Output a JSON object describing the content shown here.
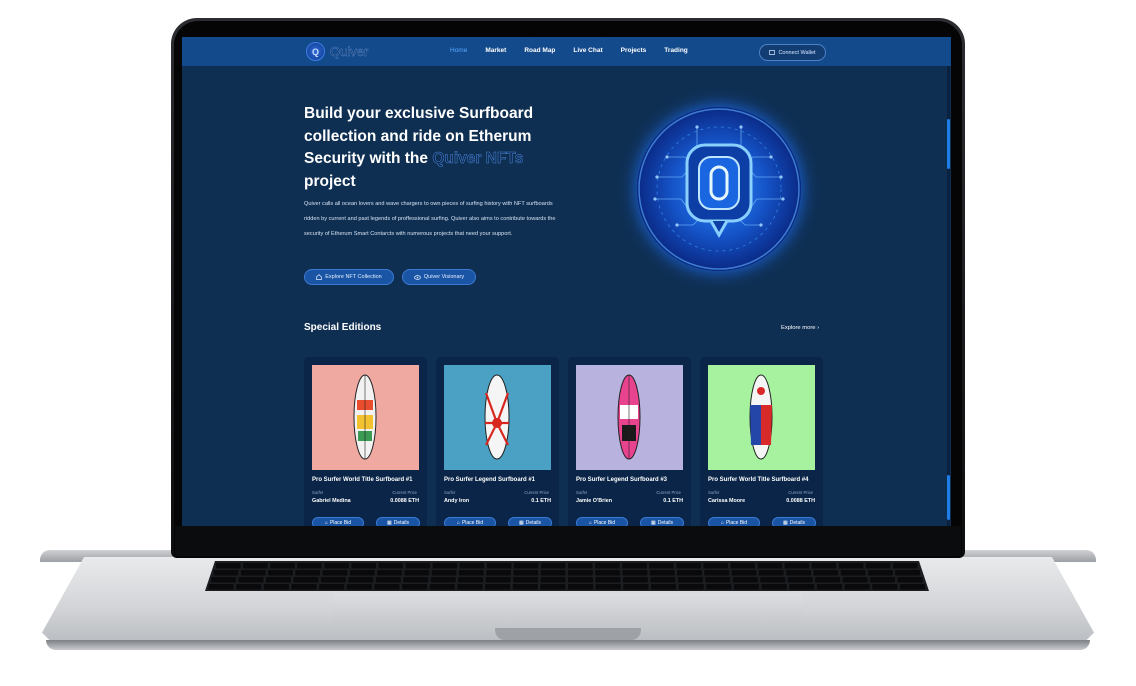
{
  "nav": {
    "logo": "Quiver",
    "links": [
      "Home",
      "Market",
      "Road Map",
      "Live Chat",
      "Projects",
      "Trading"
    ],
    "active": "Home",
    "wallet": "Connect Wallet"
  },
  "hero": {
    "title_part1": "Build your exclusive Surfboard collection and ride on Etherum Security with the",
    "title_accent": "Quiver NFTs",
    "title_part2": "project",
    "description": "Quiver calls all ocean lovers and wave chargers to own pieces of surfing history with NFT surfboards ridden by current and past legends of proffessional surfing. Quiver also aims to contribute towards the security of Etherum Smart Contarcts with numerous projects that need your support.",
    "btn_explore": "Explore NFT Collection",
    "btn_vision": "Quiver Visionary",
    "orb_letter": "Q"
  },
  "section": {
    "title": "Special Editions",
    "explore_more": "Explore more ›"
  },
  "cards": [
    {
      "title": "Pro Surfer World Title Surfboard #1",
      "surfer_label": "Surfer",
      "price_label": "Current Price",
      "surfer": "Gabriel Medina",
      "price": "0.0088 ETH",
      "bid": "Place Bid",
      "details": "Details",
      "bg": "#efa9a1"
    },
    {
      "title": "Pro Surfer Legend Surfboard #1",
      "surfer_label": "Surfer",
      "price_label": "Current Price",
      "surfer": "Andy Iron",
      "price": "0.1 ETH",
      "bid": "Place Bid",
      "details": "Details",
      "bg": "#4aa1c4"
    },
    {
      "title": "Pro Surfer Legend Surfboard #3",
      "surfer_label": "Surfer",
      "price_label": "Current Price",
      "surfer": "Jamie O'Brien",
      "price": "0.1 ETH",
      "bid": "Place Bid",
      "details": "Details",
      "bg": "#b7b2de"
    },
    {
      "title": "Pro Surfer World Title Surfboard #4",
      "surfer_label": "Surfer",
      "price_label": "Current Price",
      "surfer": "Carissa Moore",
      "price": "0.0088 ETH",
      "bid": "Place Bid",
      "details": "Details",
      "bg": "#a6f29f"
    }
  ],
  "colors": {
    "page_bg": "#0f2f52",
    "nav_bg": "#134a8c",
    "accent": "#1a55a5",
    "active_link": "#58a8ff"
  }
}
